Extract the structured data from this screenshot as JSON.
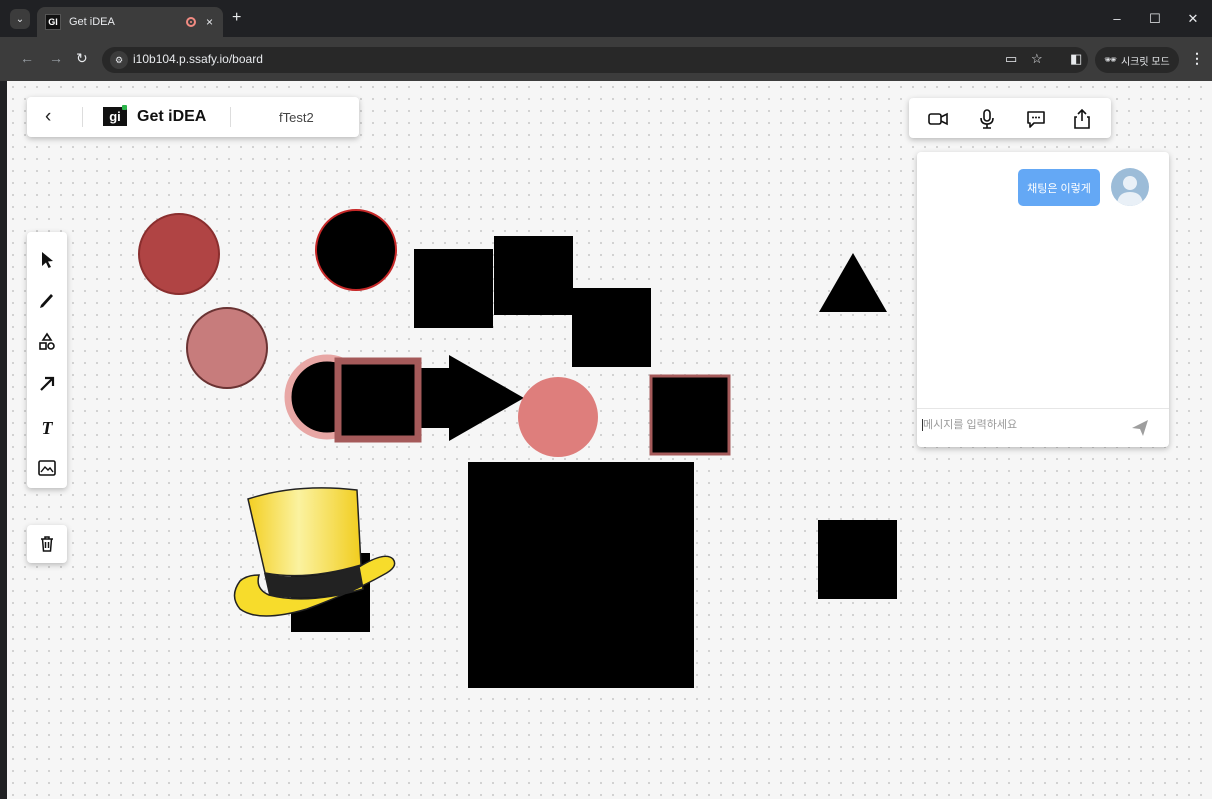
{
  "browser": {
    "tab_title": "Get iDEA",
    "favicon_text": "GI",
    "url": "i10b104.p.ssafy.io/board",
    "incognito_label": "시크릿 모드",
    "new_tab": "+",
    "close_tab": "×",
    "window_controls": [
      "–",
      "☐",
      "✕"
    ]
  },
  "header": {
    "back_icon": "‹",
    "logo_text": "gi",
    "app_name": "Get iDEA",
    "board_name": "fTest2"
  },
  "media_controls": [
    "video-icon",
    "microphone-icon",
    "chat-icon",
    "share-icon"
  ],
  "tools": [
    "select-icon",
    "pen-icon",
    "shapes-icon",
    "arrow-icon",
    "text-icon",
    "image-icon"
  ],
  "tool_glyphs": {
    "text": "T"
  },
  "chat": {
    "messages": [
      {
        "text": "채팅은 이렇게",
        "own": true
      }
    ],
    "input_placeholder": "메시지를 입력하세요"
  },
  "colors": {
    "accent_blue": "#64a8f5",
    "hat_yellow": "#f7dc2b",
    "circle_red": "#b04444",
    "circle_rose": "#c77c7c",
    "circle_pink": "#de7e7c"
  }
}
